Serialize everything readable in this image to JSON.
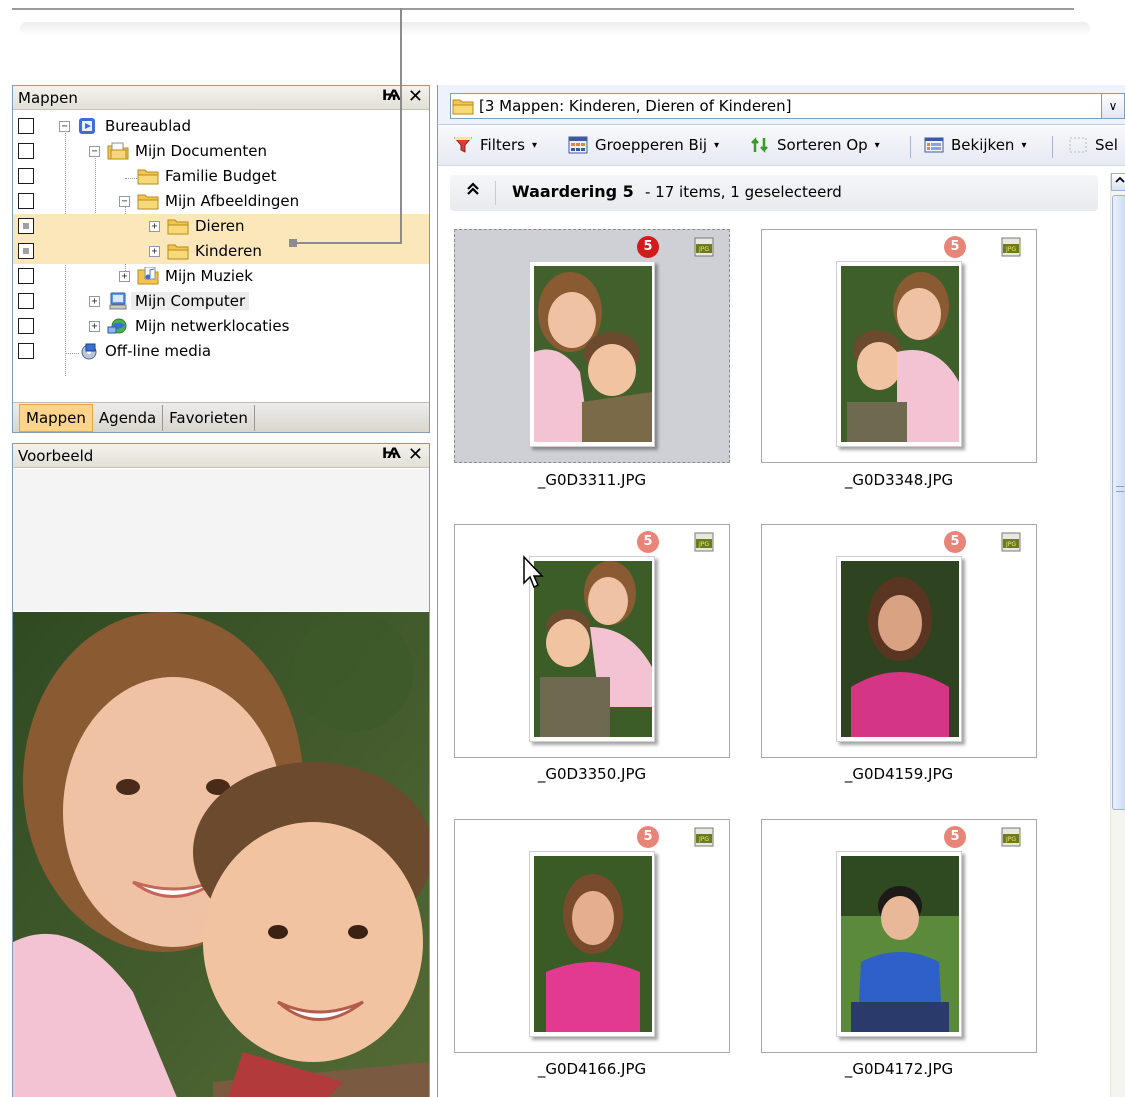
{
  "folders_panel": {
    "title": "Mappen",
    "pin_glyph": "Ѩ",
    "close_glyph": "✕",
    "tree": [
      {
        "label": "Bureaublad",
        "icon": "desktop-icon",
        "checkbox": "unchecked",
        "expander": "−"
      },
      {
        "label": "Mijn Documenten",
        "icon": "documents-folder-icon",
        "checkbox": "unchecked",
        "expander": "−"
      },
      {
        "label": "Familie Budget",
        "icon": "folder-icon",
        "checkbox": "unchecked",
        "expander": ""
      },
      {
        "label": "Mijn Afbeeldingen",
        "icon": "folder-icon",
        "checkbox": "unchecked",
        "expander": "−"
      },
      {
        "label": "Dieren",
        "icon": "folder-icon",
        "checkbox": "mixed",
        "expander": "+"
      },
      {
        "label": "Kinderen",
        "icon": "folder-icon",
        "checkbox": "mixed",
        "expander": "+"
      },
      {
        "label": "Mijn Muziek",
        "icon": "music-folder-icon",
        "checkbox": "unchecked",
        "expander": "+"
      },
      {
        "label": "Mijn Computer",
        "icon": "computer-icon",
        "checkbox": "unchecked",
        "expander": "+"
      },
      {
        "label": "Mijn netwerklocaties",
        "icon": "network-icon",
        "checkbox": "unchecked",
        "expander": "+"
      },
      {
        "label": "Off-line media",
        "icon": "offline-media-icon",
        "checkbox": "unchecked",
        "expander": ""
      }
    ],
    "tabs": [
      "Mappen",
      "Agenda",
      "Favorieten"
    ],
    "active_tab": "Mappen"
  },
  "preview_panel": {
    "title": "Voorbeeld",
    "pin_glyph": "Ѩ",
    "close_glyph": "✕"
  },
  "address_bar": {
    "text": "[3 Mappen: Kinderen, Dieren of Kinderen]",
    "dropdown_glyph": "∨"
  },
  "toolbar": {
    "filters": "Filters",
    "group_by": "Groepperen Bij",
    "sort_by": "Sorteren Op",
    "view": "Bekijken",
    "select": "Sel",
    "caret": "▾"
  },
  "group_header": {
    "collapse_glyph": "⬆",
    "title": "Waardering 5",
    "info": "- 17 items, 1 geselecteerd"
  },
  "thumbnails": [
    {
      "filename": "_G0D3311.JPG",
      "rating": "5",
      "selected": true,
      "rating_style": "dark"
    },
    {
      "filename": "_G0D3348.JPG",
      "rating": "5",
      "selected": false,
      "rating_style": "light"
    },
    {
      "filename": "_G0D3350.JPG",
      "rating": "5",
      "selected": false,
      "rating_style": "light"
    },
    {
      "filename": "_G0D4159.JPG",
      "rating": "5",
      "selected": false,
      "rating_style": "light"
    },
    {
      "filename": "_G0D4166.JPG",
      "rating": "5",
      "selected": false,
      "rating_style": "light"
    },
    {
      "filename": "_G0D4172.JPG",
      "rating": "5",
      "selected": false,
      "rating_style": "light"
    }
  ],
  "colors": {
    "highlight_row": "#fbe7b9",
    "rating_selected": "#d31b1b",
    "rating_normal": "#e98478",
    "active_tab": "#fcd48b"
  }
}
